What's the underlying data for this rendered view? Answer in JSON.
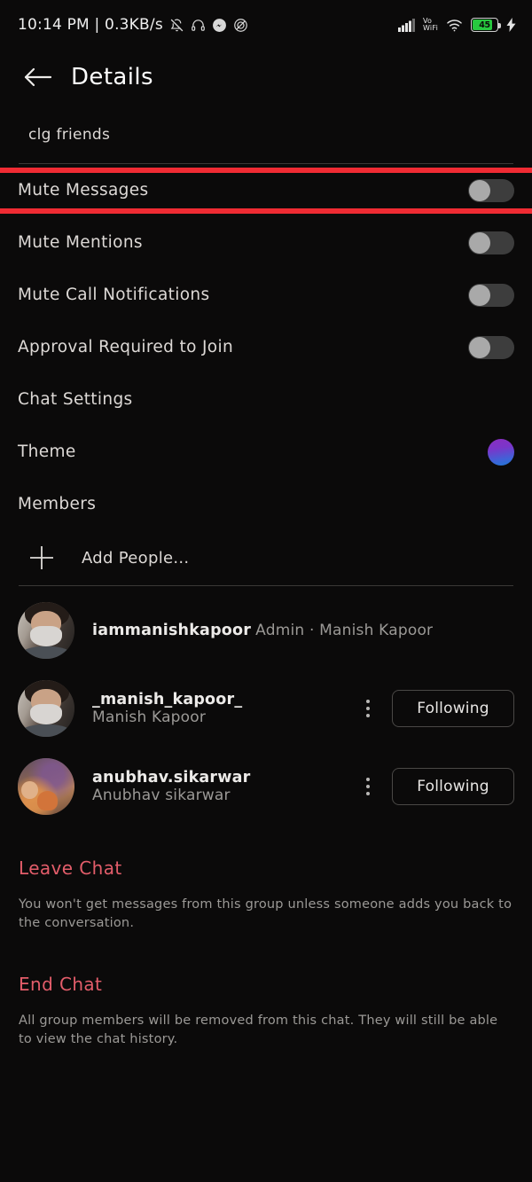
{
  "statusbar": {
    "clock": "10:14 PM | 0.3KB/s",
    "left_icons": [
      "bell-slash-icon",
      "headphones-icon",
      "messenger-icon",
      "do-not-disturb-icon"
    ],
    "signal_icon": "cellular-signal-icon",
    "vowifi_line1": "Vo",
    "vowifi_line2": "WiFi",
    "wifi_icon": "wifi-icon",
    "battery_level": "45",
    "battery_color": "#27c93f",
    "charging_icon": "charging-bolt-icon"
  },
  "header": {
    "back_icon": "back-arrow-icon",
    "title": "Details"
  },
  "group": {
    "name": "clg friends"
  },
  "settings": {
    "rows": [
      {
        "label": "Mute Messages",
        "control": "toggle",
        "state": "off",
        "highlighted": true
      },
      {
        "label": "Mute Mentions",
        "control": "toggle",
        "state": "off",
        "highlighted": false
      },
      {
        "label": "Mute Call Notifications",
        "control": "toggle",
        "state": "off",
        "highlighted": false
      },
      {
        "label": "Approval Required to Join",
        "control": "toggle",
        "state": "off",
        "highlighted": false
      },
      {
        "label": "Chat Settings",
        "control": "none",
        "state": "",
        "highlighted": false
      },
      {
        "label": "Theme",
        "control": "color-dot",
        "state": "",
        "highlighted": false
      },
      {
        "label": "Members",
        "control": "none",
        "state": "",
        "highlighted": false
      }
    ],
    "theme_color_start": "#8a2ec0",
    "theme_color_end": "#1f79d6",
    "highlight_color": "#f02b33"
  },
  "add_people": {
    "icon": "plus-icon",
    "label": "Add People..."
  },
  "members": [
    {
      "username": "iammanishkapoor",
      "subtitle": "Admin · Manish Kapoor",
      "avatar": "person-masked-photo",
      "has_menu": false,
      "action_label": ""
    },
    {
      "username": "_manish_kapoor_",
      "subtitle": "Manish Kapoor",
      "avatar": "person-masked-photo",
      "has_menu": true,
      "action_label": "Following"
    },
    {
      "username": "anubhav.sikarwar",
      "subtitle": "Anubhav sikarwar",
      "avatar": "celebration-scene-photo",
      "has_menu": true,
      "action_label": "Following"
    }
  ],
  "danger": {
    "accent_color": "#e35d6a",
    "leave": {
      "title": "Leave Chat",
      "description": "You won't get messages from this group unless someone adds you back to the conversation."
    },
    "end": {
      "title": "End Chat",
      "description": "All group members will be removed from this chat. They will still be able to view the chat history."
    }
  }
}
